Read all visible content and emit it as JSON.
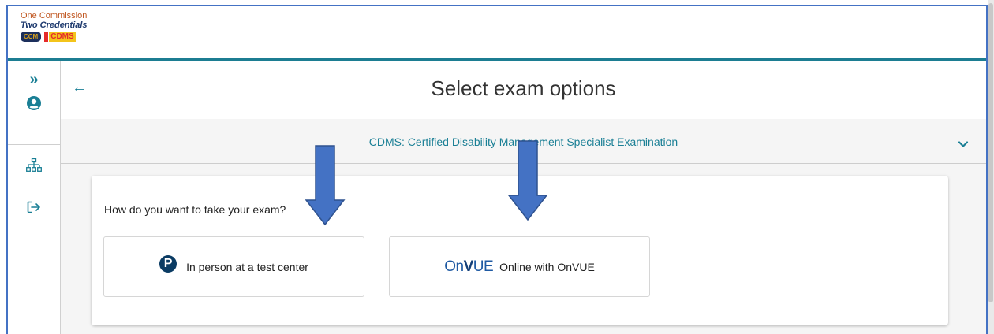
{
  "logo": {
    "line1": "One Commission",
    "line2": "Two Credentials",
    "badge_ccm": "CCM",
    "badge_cdms": "CDMS"
  },
  "sidebar": {
    "items": [
      {
        "icon": "expand-icon",
        "glyph": "»"
      },
      {
        "icon": "user-icon"
      },
      {
        "icon": "sitemap-icon"
      },
      {
        "icon": "logout-icon"
      }
    ]
  },
  "page": {
    "back_glyph": "←",
    "title": "Select exam options"
  },
  "exam": {
    "title": "CDMS: Certified Disability Management Specialist Examination"
  },
  "card": {
    "question": "How do you want to take your exam?",
    "options": [
      {
        "label": "In person at a test center",
        "icon": "pearson-icon",
        "icon_glyph": "P"
      },
      {
        "label": "Online with OnVUE",
        "icon": "onvue-logo",
        "logo_text_a": "On",
        "logo_text_b": "V",
        "logo_text_c": "UE"
      }
    ]
  },
  "colors": {
    "accent": "#1a7f95",
    "header_border": "#1c7d92",
    "annotation_arrow": "#4472c4"
  }
}
